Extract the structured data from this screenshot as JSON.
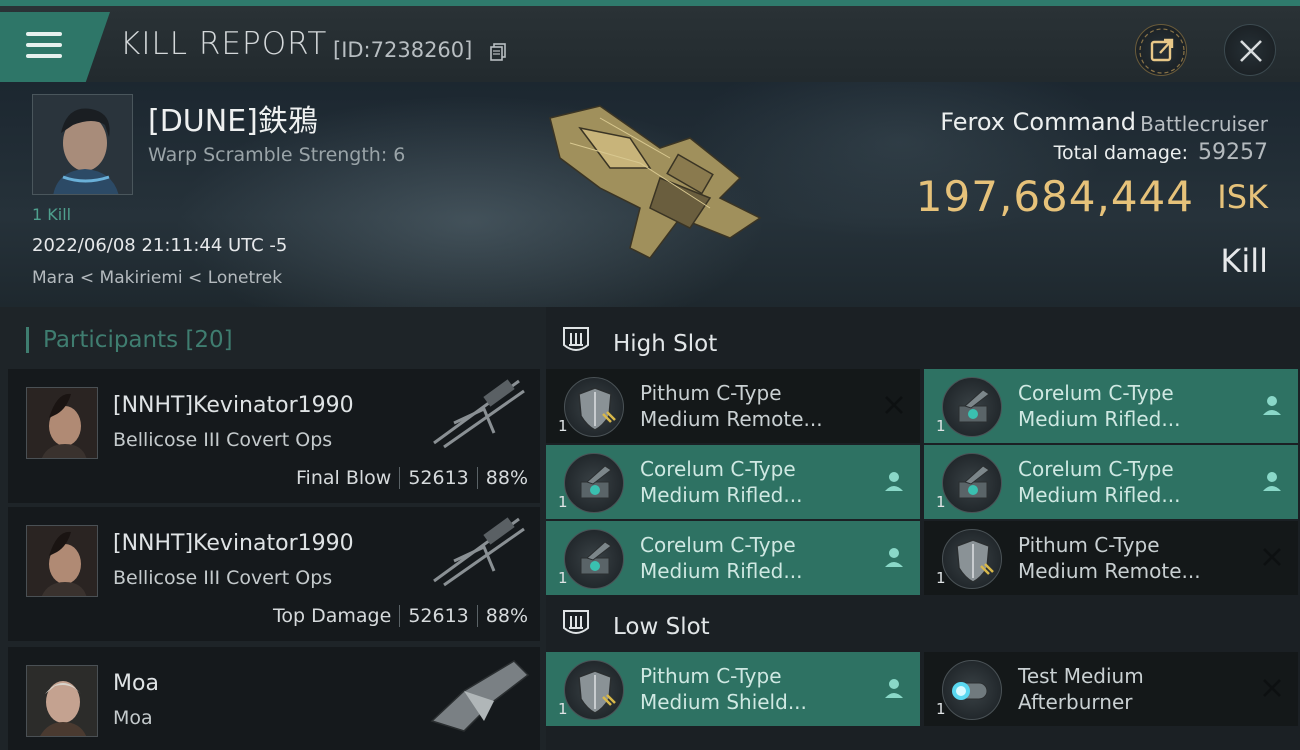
{
  "header": {
    "title": "KILL REPORT",
    "report_id": "[ID:7238260]"
  },
  "victim": {
    "pilot_name": "[DUNE]鉄鴉",
    "warp_scramble": "Warp Scramble Strength: 6",
    "kill_tag": "1 Kill",
    "datetime": "2022/06/08 21:11:44 UTC -5",
    "location": "Mara < Makiriemi < Lonetrek",
    "ship_name": "Ferox Command",
    "ship_class": "Battlecruiser",
    "total_damage_label": "Total damage:",
    "total_damage": "59257",
    "isk_value": "197,684,444",
    "isk_unit": "ISK",
    "status": "Kill"
  },
  "participants": {
    "title": "Participants [20]",
    "items": [
      {
        "name": "[NNHT]Kevinator1990",
        "ship": "Bellicose III Covert Ops",
        "role": "Final Blow",
        "damage": "52613",
        "percent": "88%"
      },
      {
        "name": "[NNHT]Kevinator1990",
        "ship": "Bellicose III Covert Ops",
        "role": "Top Damage",
        "damage": "52613",
        "percent": "88%"
      },
      {
        "name": "Moa",
        "ship": "Moa"
      }
    ]
  },
  "slots": {
    "high_title": "High Slot",
    "low_title": "Low Slot",
    "high": [
      {
        "line1": "Pithum C-Type",
        "line2": "Medium Remote...",
        "qty": "1",
        "state": "destroyed"
      },
      {
        "line1": "Corelum C-Type",
        "line2": "Medium Rifled...",
        "qty": "1",
        "state": "dropped"
      },
      {
        "line1": "Corelum C-Type",
        "line2": "Medium Rifled...",
        "qty": "1",
        "state": "dropped"
      },
      {
        "line1": "Corelum C-Type",
        "line2": "Medium Rifled...",
        "qty": "1",
        "state": "dropped"
      },
      {
        "line1": "Corelum C-Type",
        "line2": "Medium Rifled...",
        "qty": "1",
        "state": "dropped"
      },
      {
        "line1": "Pithum C-Type",
        "line2": "Medium Remote...",
        "qty": "1",
        "state": "destroyed"
      }
    ],
    "low": [
      {
        "line1": "Pithum C-Type",
        "line2": "Medium Shield...",
        "qty": "1",
        "state": "dropped"
      },
      {
        "line1": "Test Medium",
        "line2": "Afterburner",
        "qty": "1",
        "state": "destroyed"
      }
    ]
  },
  "colors": {
    "accent": "#2e7668",
    "isk": "#e6c27a",
    "dropped_bg": "#2e7263"
  }
}
